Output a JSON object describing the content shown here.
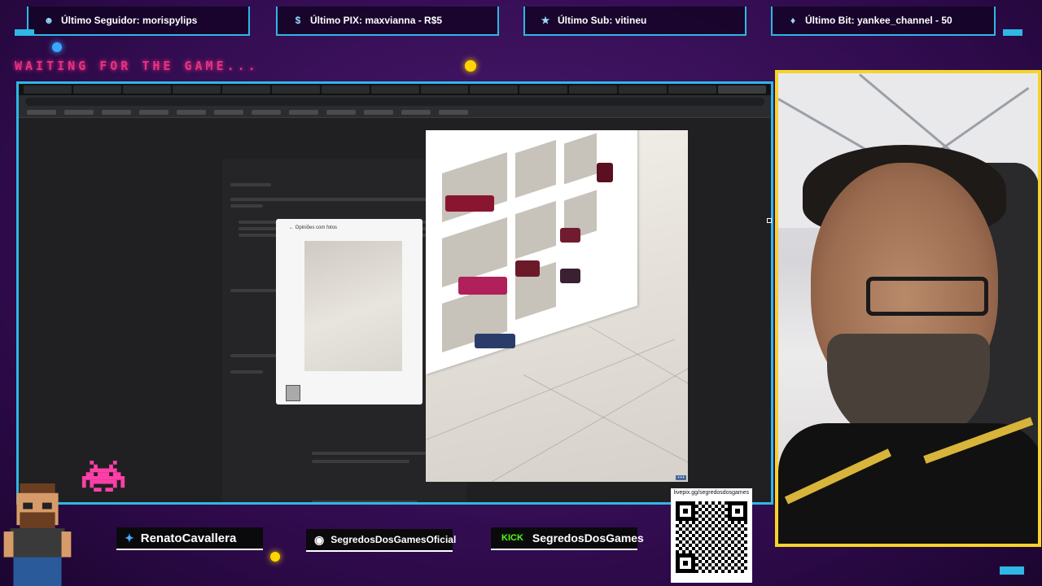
{
  "top_bar": {
    "follower": {
      "icon": "user-icon",
      "text": "Último Seguidor: morispylips"
    },
    "pix": {
      "icon": "dollar-icon",
      "text": "Último PIX: maxvianna - R$5"
    },
    "sub": {
      "icon": "star-icon",
      "text": "Último Sub: vitineu"
    },
    "bit": {
      "icon": "diamond-icon",
      "text": "Último Bit: yankee_channel - 50"
    }
  },
  "waiting_text": "WAITING FOR THE GAME...",
  "review_modal": {
    "header": "Opiniões com fotos"
  },
  "bottom_bar": {
    "twitter": {
      "icon": "twitter-icon",
      "handle": "RenatoCavallera"
    },
    "instagram": {
      "icon": "instagram-icon",
      "handle": "SegredosDosGamesOficial"
    },
    "kick": {
      "icon": "kick-icon",
      "badge": "KICK",
      "handle": "SegredosDosGames"
    },
    "qr": {
      "label": "livepix.gg/segredosdosgames"
    }
  },
  "colors": {
    "frame_accent": "#2fb7e6",
    "webcam_border": "#f5d32a",
    "waiting_text": "#e5337f",
    "background": "#3a0f5c"
  }
}
